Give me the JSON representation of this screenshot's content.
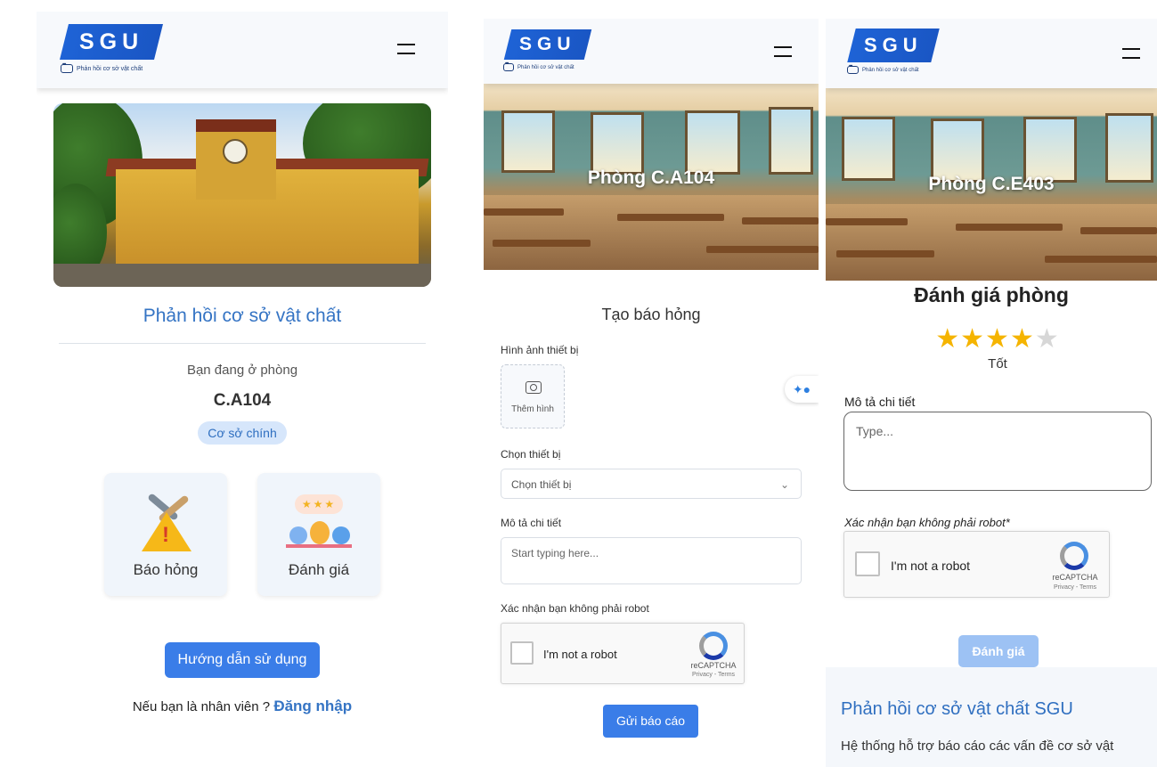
{
  "brand": {
    "logo_text": "SGU",
    "tagline": "Phản hồi cơ sở vật chất"
  },
  "colors": {
    "primary": "#3a7de8",
    "primary_text": "#3574c4",
    "disabled_button": "#9dc2f4",
    "badge_bg": "#d6e6fb",
    "star": "#f5b400"
  },
  "home": {
    "title": "Phản hồi cơ sở vật chất",
    "current_room_label": "Bạn đang ở phòng",
    "room_code": "C.A104",
    "campus_badge": "Cơ sở chính",
    "tiles": [
      {
        "label": "Báo hỏng",
        "icon": "warning-tools-icon"
      },
      {
        "label": "Đánh giá",
        "icon": "rating-people-icon"
      }
    ],
    "guide_button": "Hướng dẫn sử dụng",
    "staff_prompt": "Nếu bạn là nhân viên ?",
    "login_link": "Đăng nhập"
  },
  "report": {
    "room_title": "Phòng C.A104",
    "form_title": "Tạo báo hỏng",
    "image_label": "Hình ảnh thiết bị",
    "add_image": "Thêm hình",
    "device_label": "Chọn thiết bị",
    "device_placeholder": "Chọn thiết bị",
    "description_label": "Mô tả chi tiết",
    "description_placeholder": "Start typing here...",
    "robot_label": "Xác nhận bạn không phải robot",
    "submit_button": "Gửi báo cáo"
  },
  "recaptcha": {
    "checkbox_label": "I'm not a robot",
    "brand": "reCAPTCHA",
    "terms": "Privacy - Terms"
  },
  "rating": {
    "room_title": "Phòng C.E403",
    "form_title": "Đánh giá phòng",
    "stars": 4,
    "max_stars": 5,
    "rating_label": "Tốt",
    "description_label": "Mô tả chi tiết",
    "description_placeholder": "Type...",
    "robot_label": "Xác nhận bạn không phải robot*",
    "submit_button": "Đánh giá",
    "footer_title": "Phản hồi cơ sở vật chất SGU",
    "footer_text": "Hệ thống hỗ trợ báo cáo các vấn đề cơ sở vật"
  }
}
